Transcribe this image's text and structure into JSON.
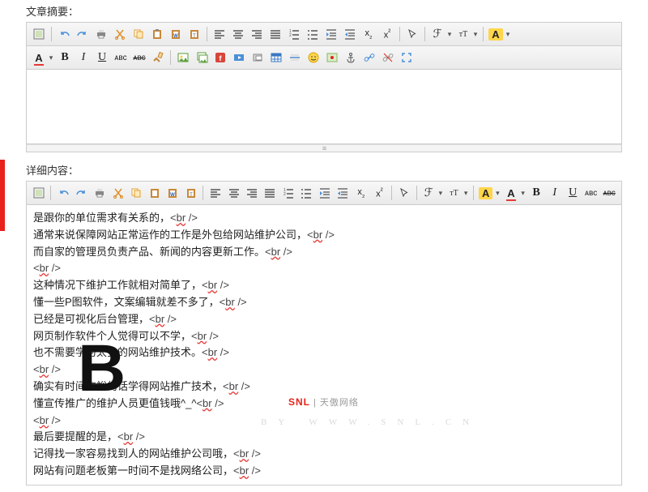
{
  "labels": {
    "summary": "文章摘要：",
    "detail": "详细内容："
  },
  "content_lines": [
    {
      "text": "是跟你的单位需求有关系的，",
      "br": true
    },
    {
      "text": "通常来说保障网站正常运作的工作是外包给网站维护公司，",
      "br": true
    },
    {
      "text": "而自家的管理员负责产品、新闻的内容更新工作。",
      "br": true
    },
    {
      "text": "",
      "br": true
    },
    {
      "text": "这种情况下维护工作就相对简单了，",
      "br": true
    },
    {
      "text": "懂一些P图软件，文案编辑就差不多了，",
      "br": true
    },
    {
      "text": "已经是可视化后台管理，",
      "br": true
    },
    {
      "text": "网页制作软件个人觉得可以不学，",
      "br": true
    },
    {
      "text": "也不需要学习太多的网站维护技术。",
      "br": true
    },
    {
      "text": "",
      "br": true
    },
    {
      "text": "确实有时间充裕的话学得网站推广技术，",
      "br": true
    },
    {
      "text": "懂宣传推广的维护人员更值钱哦^_^",
      "br": true
    },
    {
      "text": "",
      "br": true
    },
    {
      "text": "最后要提醒的是，",
      "br": true
    },
    {
      "text": "记得找一家容易找到人的网站维护公司哦，",
      "br": true
    },
    {
      "text": "网站有问题老板第一时间不是找网络公司，",
      "br": true
    }
  ],
  "watermark": {
    "big_letter": "B",
    "brand": "SNL",
    "brand_cn": "天傲网络",
    "url_spaced": "BY  WWW.SNL.CN"
  },
  "icons": {
    "source": "source-icon",
    "undo": "undo-icon",
    "redo": "redo-icon",
    "print": "print-icon",
    "cut": "cut-icon",
    "copy": "copy-icon",
    "paste": "paste-icon",
    "paste-word": "paste-word-icon",
    "paste-plain": "paste-plain-icon",
    "align-left": "align-left-icon",
    "align-center": "align-center-icon",
    "align-right": "align-right-icon",
    "align-justify": "align-justify-icon",
    "list-ol": "list-ol-icon",
    "list-ul": "list-ul-icon",
    "indent": "indent-icon",
    "outdent": "outdent-icon",
    "sub": "subscript-icon",
    "sup": "superscript-icon",
    "select": "select-icon",
    "fontname": "fontname-icon",
    "fontsize": "fontsize-icon",
    "hilite": "hilite-icon",
    "forecolor": "forecolor-icon",
    "bold": "bold-icon",
    "italic": "italic-icon",
    "underline": "underline-icon",
    "abc": "spellcheck-icon",
    "strike": "strike-icon",
    "removeformat": "removeformat-icon",
    "image": "image-icon",
    "multiimage": "multiimage-icon",
    "flash": "flash-icon",
    "media": "media-icon",
    "file": "file-icon",
    "table": "table-icon",
    "hr": "hr-icon",
    "emoji": "emoji-icon",
    "map": "map-icon",
    "anchor": "anchor-icon",
    "link": "link-icon",
    "fullscreen": "fullscreen-icon"
  }
}
